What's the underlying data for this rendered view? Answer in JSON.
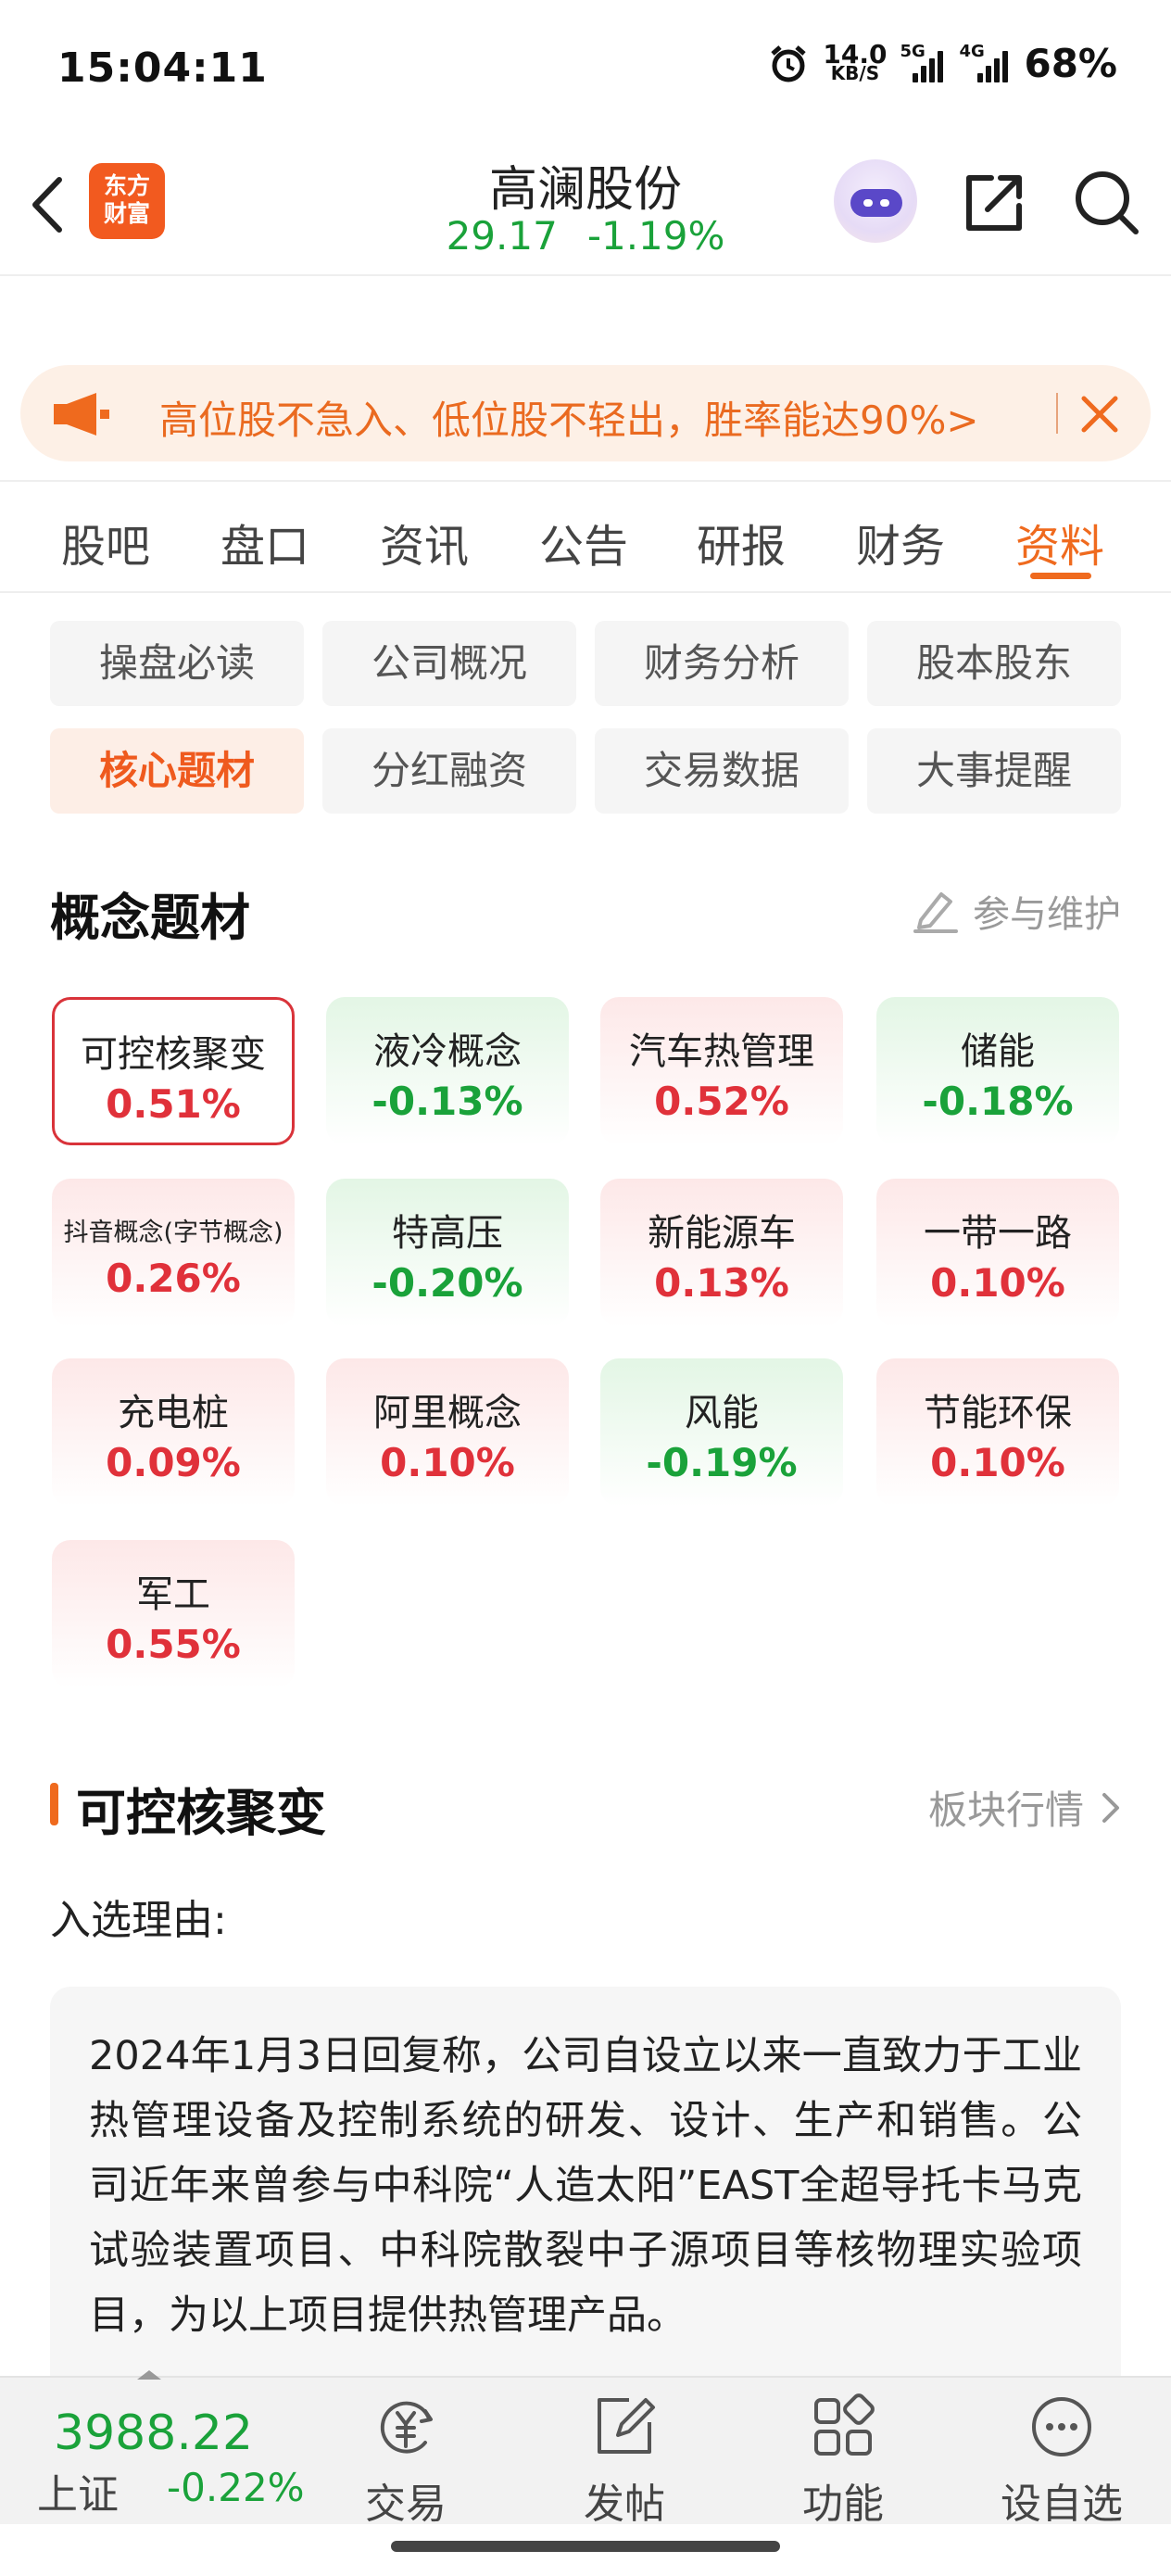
{
  "status_bar": {
    "time": "15:04:11",
    "net_speed_value": "14.0",
    "net_speed_unit": "KB/S",
    "sim1_tag": "5G",
    "sim2_tag": "4G",
    "battery": "68%"
  },
  "header": {
    "logo_line1": "东方",
    "logo_line2": "财富",
    "stock_name": "高澜股份",
    "price": "29.17",
    "change_pct": "-1.19%"
  },
  "banner": {
    "text": "高位股不急入、低位股不轻出，胜率能达90%>"
  },
  "tabs": [
    "股吧",
    "盘口",
    "资讯",
    "公告",
    "研报",
    "财务",
    "资料"
  ],
  "active_tab": "资料",
  "sub_tabs": [
    "操盘必读",
    "公司概况",
    "财务分析",
    "股本股东",
    "核心题材",
    "分红融资",
    "交易数据",
    "大事提醒"
  ],
  "active_sub_tab": "核心题材",
  "concept_section": {
    "title": "概念题材",
    "maintain_label": "参与维护",
    "chips": [
      {
        "name": "可控核聚变",
        "pct": "0.51%",
        "trend": "up",
        "selected": true
      },
      {
        "name": "液冷概念",
        "pct": "-0.13%",
        "trend": "down"
      },
      {
        "name": "汽车热管理",
        "pct": "0.52%",
        "trend": "up"
      },
      {
        "name": "储能",
        "pct": "-0.18%",
        "trend": "down"
      },
      {
        "name": "抖音概念(字节概念)",
        "pct": "0.26%",
        "trend": "up"
      },
      {
        "name": "特高压",
        "pct": "-0.20%",
        "trend": "down"
      },
      {
        "name": "新能源车",
        "pct": "0.13%",
        "trend": "up"
      },
      {
        "name": "一带一路",
        "pct": "0.10%",
        "trend": "up"
      },
      {
        "name": "充电桩",
        "pct": "0.09%",
        "trend": "up"
      },
      {
        "name": "阿里概念",
        "pct": "0.10%",
        "trend": "up"
      },
      {
        "name": "风能",
        "pct": "-0.19%",
        "trend": "down"
      },
      {
        "name": "节能环保",
        "pct": "0.10%",
        "trend": "up"
      },
      {
        "name": "军工",
        "pct": "0.55%",
        "trend": "up"
      }
    ]
  },
  "detail": {
    "title": "可控核聚变",
    "board_link": "板块行情",
    "reason_label": "入选理由:",
    "reason_text": "2024年1月3日回复称，公司自设立以来一直致力于工业热管理设备及控制系统的研发、设计、生产和销售。公司近年来曾参与中科院“人造太阳”EAST全超导托卡马克试验装置项目、中科院散裂中子源项目等核物理实验项目，为以上项目提供热管理产品。"
  },
  "bottom_bar": {
    "index_value": "3988.22",
    "index_name": "上证",
    "index_change": "-0.22%",
    "nav": [
      "交易",
      "发帖",
      "功能",
      "设自选"
    ]
  },
  "colors": {
    "accent": "#ef6a1e",
    "up": "#e0313a",
    "down": "#1aa23a"
  }
}
